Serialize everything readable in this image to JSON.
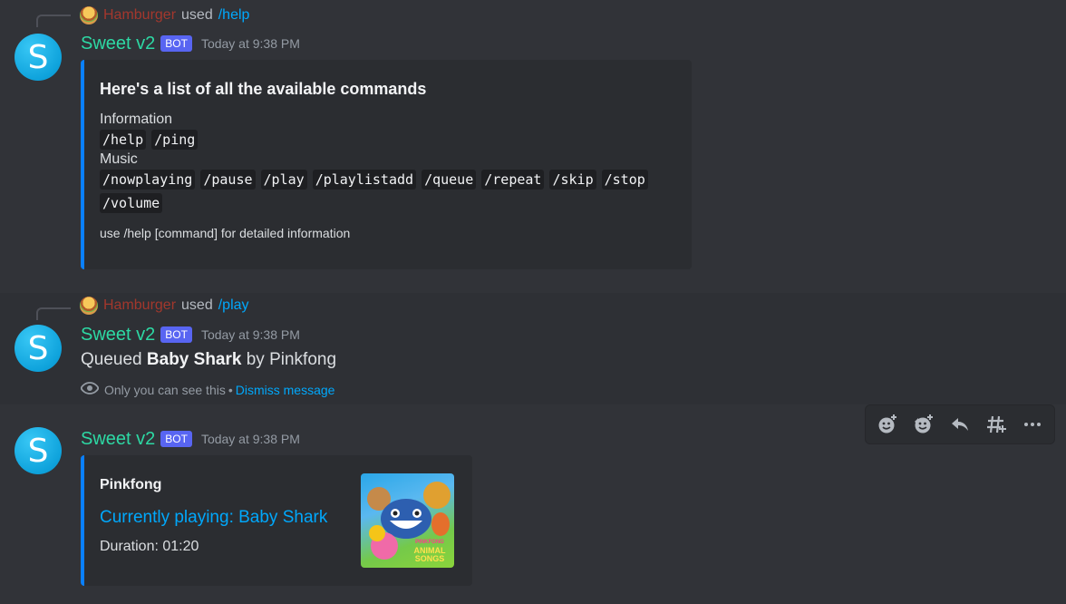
{
  "messages": [
    {
      "reply": {
        "user": "Hamburger",
        "used": "used",
        "command": "/help"
      },
      "author": "Sweet v2",
      "avatar_letter": "S",
      "bot_tag": "BOT",
      "timestamp": "Today at 9:38 PM",
      "embed": {
        "title": "Here's a list of all the available commands",
        "sections": [
          {
            "name": "Information",
            "commands": [
              "/help",
              "/ping"
            ]
          },
          {
            "name": "Music",
            "commands": [
              "/nowplaying",
              "/pause",
              "/play",
              "/playlistadd",
              "/queue",
              "/repeat",
              "/skip",
              "/stop",
              "/volume"
            ]
          }
        ],
        "footer": "use /help [command] for detailed information"
      }
    },
    {
      "reply": {
        "user": "Hamburger",
        "used": "used",
        "command": "/play"
      },
      "author": "Sweet v2",
      "avatar_letter": "S",
      "bot_tag": "BOT",
      "timestamp": "Today at 9:38 PM",
      "content": {
        "prefix": "Queued",
        "song": "Baby Shark",
        "mid": "by",
        "artist": "Pinkfong"
      },
      "ephemeral": {
        "note": "Only you can see this",
        "separator": "•",
        "dismiss": "Dismiss message"
      }
    },
    {
      "author": "Sweet v2",
      "avatar_letter": "S",
      "bot_tag": "BOT",
      "timestamp": "Today at 9:38 PM",
      "embed": {
        "author": "Pinkfong",
        "title": "Currently playing: Baby Shark",
        "description": "Duration: 01:20",
        "thumbnail_text": [
          "PINKFONG",
          "ANIMAL",
          "SONGS"
        ]
      }
    }
  ],
  "toolbar": {
    "icons": [
      "add-reaction-icon",
      "add-super-reaction-icon",
      "reply-icon",
      "create-thread-icon",
      "more-icon"
    ]
  },
  "colors": {
    "background": "#313338",
    "embed_bar": "#0a80ff",
    "bot_name": "#2dd9a4",
    "link": "#00a8fc",
    "bot_badge": "#5865f2"
  }
}
